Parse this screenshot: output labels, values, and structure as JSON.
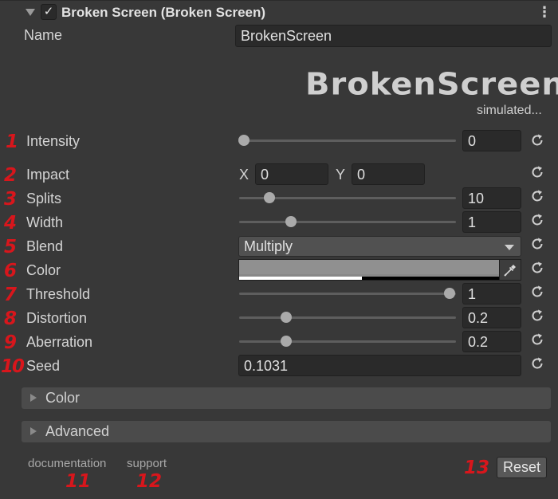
{
  "header": {
    "title": "Broken Screen (Broken Screen)",
    "enabled": true,
    "menu_icon": "kebab-menu-icon"
  },
  "name_field": {
    "label": "Name",
    "value": "BrokenScreen"
  },
  "logo": {
    "text": "BrokenScreen",
    "status": "simulated..."
  },
  "properties": {
    "intensity": {
      "num": "1",
      "label": "Intensity",
      "value": "0",
      "slider_fraction": 0.0
    },
    "impact": {
      "num": "2",
      "label": "Impact",
      "x_label": "X",
      "x_value": "0",
      "y_label": "Y",
      "y_value": "0"
    },
    "splits": {
      "num": "3",
      "label": "Splits",
      "value": "10",
      "slider_fraction": 0.12
    },
    "width": {
      "num": "4",
      "label": "Width",
      "value": "1",
      "slider_fraction": 0.22
    },
    "blend": {
      "num": "5",
      "label": "Blend",
      "value": "Multiply"
    },
    "color": {
      "num": "6",
      "label": "Color",
      "swatch_hex": "#909090",
      "alpha_fraction": 0.47
    },
    "threshold": {
      "num": "7",
      "label": "Threshold",
      "value": "1",
      "slider_fraction": 1.0
    },
    "distortion": {
      "num": "8",
      "label": "Distortion",
      "value": "0.2",
      "slider_fraction": 0.2
    },
    "aberration": {
      "num": "9",
      "label": "Aberration",
      "value": "0.2",
      "slider_fraction": 0.2
    },
    "seed": {
      "num": "10",
      "label": "Seed",
      "value": "0.1031"
    }
  },
  "foldouts": {
    "color": "Color",
    "advanced": "Advanced"
  },
  "footer": {
    "documentation": "documentation",
    "documentation_num": "11",
    "support": "support",
    "support_num": "12",
    "reset_num": "13",
    "reset_label": "Reset"
  },
  "colors": {
    "annotation": "#d8161c",
    "background": "#383838",
    "field": "#2a2a2a"
  }
}
